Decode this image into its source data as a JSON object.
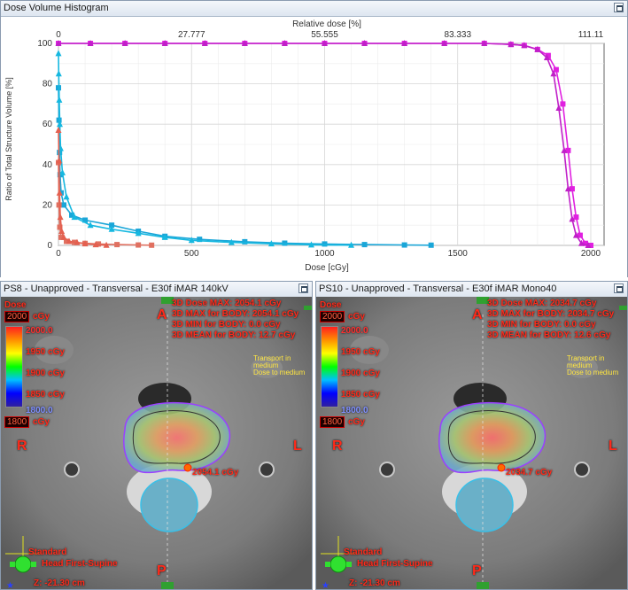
{
  "dvh": {
    "title": "Dose Volume Histogram",
    "top_axis_title": "Relative dose [%]",
    "top_ticks": [
      "0",
      "27.777",
      "55.555",
      "83.333",
      "111.11"
    ],
    "bottom_axis_title": "Dose [cGy]",
    "bottom_ticks": [
      "0",
      "500",
      "1000",
      "1500",
      "2000"
    ],
    "y_axis_title": "Ratio of Total Structure Volume [%]",
    "y_ticks": [
      "0",
      "20",
      "40",
      "60",
      "80",
      "100"
    ]
  },
  "chart_data": {
    "type": "line",
    "xlabel": "Dose [cGy]",
    "ylabel": "Ratio of Total Structure Volume [%]",
    "x2label": "Relative dose [%]",
    "xlim": [
      0,
      2050
    ],
    "ylim": [
      0,
      100
    ],
    "grid": true,
    "series": [
      {
        "color": "#e020e0",
        "marker": "square",
        "x": [
          0,
          120,
          250,
          400,
          550,
          700,
          850,
          1000,
          1150,
          1300,
          1450,
          1600,
          1700,
          1750,
          1800,
          1840,
          1870,
          1895,
          1915,
          1930,
          1945,
          1960,
          1980,
          2000
        ],
        "y": [
          100,
          100,
          100,
          100,
          100,
          100,
          100,
          100,
          100,
          100,
          100,
          100,
          99.5,
          99,
          97,
          94,
          87,
          70,
          47,
          28,
          14,
          5,
          1,
          0
        ]
      },
      {
        "color": "#c020c8",
        "marker": "triangle",
        "x": [
          0,
          120,
          250,
          400,
          550,
          700,
          850,
          1000,
          1150,
          1300,
          1450,
          1600,
          1700,
          1750,
          1800,
          1835,
          1860,
          1880,
          1900,
          1915,
          1930,
          1945,
          1965,
          1990
        ],
        "y": [
          100,
          100,
          100,
          100,
          100,
          100,
          100,
          100,
          100,
          100,
          100,
          100,
          99.5,
          99,
          97,
          93,
          85,
          68,
          47,
          28,
          13,
          5,
          1,
          0
        ]
      },
      {
        "color": "#1aa6d8",
        "marker": "square",
        "x": [
          0,
          2,
          4,
          6,
          10,
          20,
          50,
          100,
          200,
          300,
          400,
          530,
          700,
          850,
          1000,
          1150,
          1300,
          1400
        ],
        "y": [
          78,
          62,
          46,
          35,
          26,
          20,
          15,
          12.5,
          10,
          7,
          4.5,
          3,
          1.8,
          1.1,
          0.7,
          0.4,
          0.2,
          0.1
        ]
      },
      {
        "color": "#16b8e0",
        "marker": "triangle",
        "x": [
          0,
          1,
          3,
          5,
          8,
          15,
          30,
          60,
          120,
          200,
          300,
          400,
          500,
          650,
          800,
          950,
          1100
        ],
        "y": [
          95,
          85,
          72,
          60,
          48,
          36,
          24,
          14,
          10,
          8,
          6,
          4,
          2.5,
          1.5,
          0.8,
          0.3,
          0.1
        ]
      },
      {
        "color": "#e07060",
        "marker": "square",
        "x": [
          0,
          2,
          5,
          10,
          30,
          60,
          100,
          150,
          220,
          300,
          350
        ],
        "y": [
          41,
          20,
          9,
          4,
          2,
          1.5,
          1,
          0.7,
          0.4,
          0.2,
          0.1
        ]
      },
      {
        "color": "#e46050",
        "marker": "triangle",
        "x": [
          0,
          2,
          4,
          7,
          12,
          20,
          40,
          70,
          100,
          140,
          180
        ],
        "y": [
          57,
          42,
          26,
          14,
          7,
          4,
          2,
          1.4,
          0.8,
          0.4,
          0.1
        ]
      }
    ]
  },
  "left_view": {
    "title": "PS8  -  Unapproved - Transversal - E30f iMAR 140kV",
    "dose_label": "Dose",
    "max_box": "2000",
    "min_box": "1800",
    "unit": "cGy",
    "scale_top": "2000.0",
    "scale_labels": [
      "1950 cGy",
      "1900 cGy",
      "1850 cGy"
    ],
    "scale_bottom": "1800.0",
    "stats": [
      "3D Dose MAX: 2054.1 cGy",
      "3D MAX for BODY: 2054.1 cGy",
      "3D MIN for BODY: 0.0 cGy",
      "3D MEAN for BODY: 12.7 cGy"
    ],
    "transport": [
      "Transport in",
      "medium",
      "Dose to medium"
    ],
    "point_label": "2054.1 cGy",
    "orient_a": "A",
    "orient_p": "P",
    "orient_r": "R",
    "orient_l": "L",
    "standard": "Standard",
    "position": "Head First-Supine",
    "z": "Z:  -21.30 cm"
  },
  "right_view": {
    "title": "PS10  -  Unapproved - Transversal - E30f iMAR Mono40",
    "dose_label": "Dose",
    "max_box": "2000",
    "min_box": "1800",
    "unit": "cGy",
    "scale_top": "2000.0",
    "scale_labels": [
      "1950 cGy",
      "1900 cGy",
      "1850 cGy"
    ],
    "scale_bottom": "1800.0",
    "stats": [
      "3D Dose MAX: 2034.7 cGy",
      "3D MAX for BODY: 2034.7 cGy",
      "3D MIN for BODY: 0.0 cGy",
      "3D MEAN for BODY: 12.6 cGy"
    ],
    "transport": [
      "Transport in",
      "medium",
      "Dose to medium"
    ],
    "point_label": "2034.7 cGy",
    "orient_a": "A",
    "orient_p": "P",
    "orient_r": "R",
    "orient_l": "L",
    "standard": "Standard",
    "position": "Head First-Supine",
    "z": "Z:  -21.30 cm"
  },
  "colors": {
    "ptv": "#e020e0",
    "cord": "#1aa6d8",
    "other": "#e07060",
    "overlay_red": "#ff2a1a",
    "overlay_yellow": "#ffe640"
  },
  "icons": {
    "maximize": "maximize-icon",
    "orientation": "patient-orientation-icon"
  }
}
